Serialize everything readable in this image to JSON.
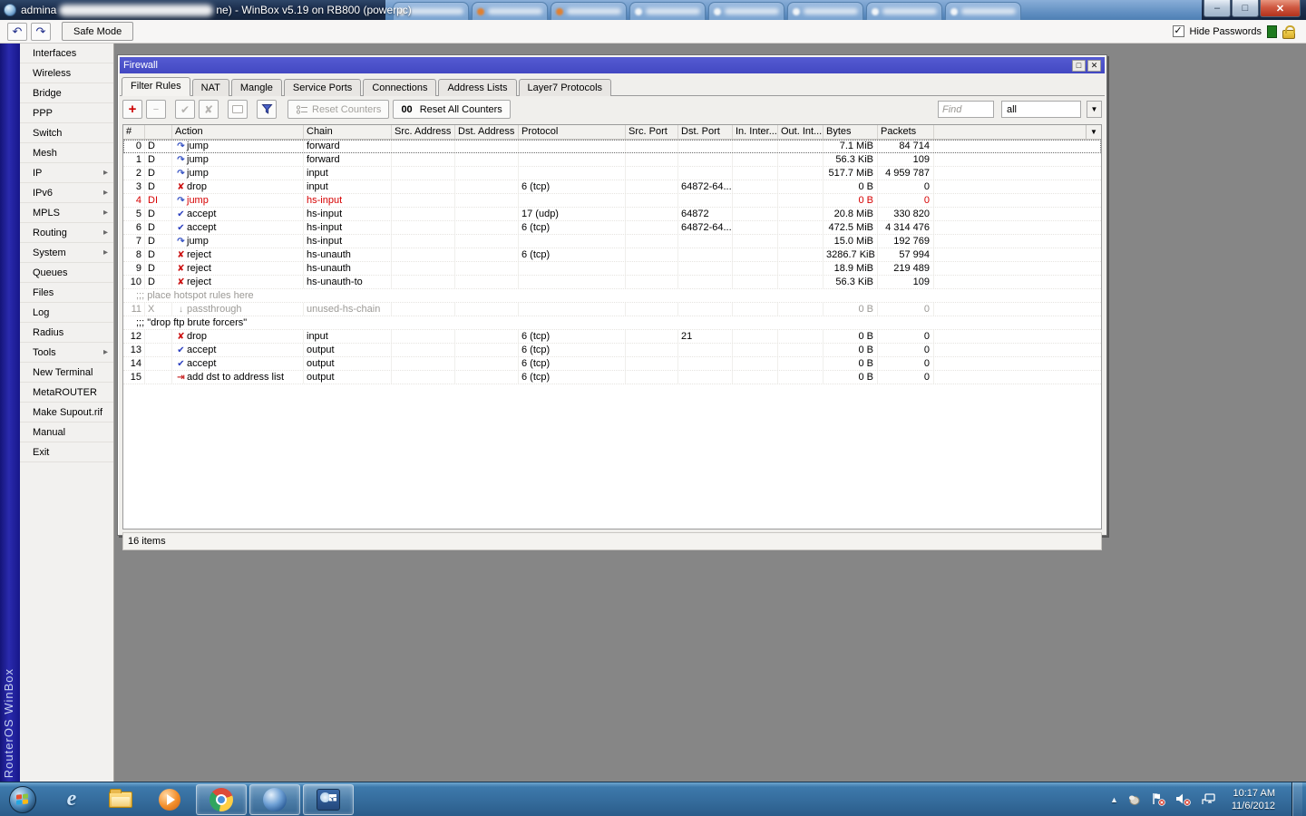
{
  "titlebar": {
    "title_prefix": "admina",
    "title_suffix": "ne) - WinBox v5.19 on RB800 (powerpc)",
    "buttons": {
      "minimize": "–",
      "maximize": "□",
      "close": "✕"
    }
  },
  "topbar": {
    "undo_icon": "↶",
    "redo_icon": "↷",
    "safe_mode_label": "Safe Mode",
    "hide_passwords_label": "Hide Passwords"
  },
  "sidebar": {
    "brand": "RouterOS WinBox",
    "items": [
      {
        "label": "Interfaces",
        "submenu": false
      },
      {
        "label": "Wireless",
        "submenu": false
      },
      {
        "label": "Bridge",
        "submenu": false
      },
      {
        "label": "PPP",
        "submenu": false
      },
      {
        "label": "Switch",
        "submenu": false
      },
      {
        "label": "Mesh",
        "submenu": false
      },
      {
        "label": "IP",
        "submenu": true
      },
      {
        "label": "IPv6",
        "submenu": true
      },
      {
        "label": "MPLS",
        "submenu": true
      },
      {
        "label": "Routing",
        "submenu": true
      },
      {
        "label": "System",
        "submenu": true
      },
      {
        "label": "Queues",
        "submenu": false
      },
      {
        "label": "Files",
        "submenu": false
      },
      {
        "label": "Log",
        "submenu": false
      },
      {
        "label": "Radius",
        "submenu": false
      },
      {
        "label": "Tools",
        "submenu": true
      },
      {
        "label": "New Terminal",
        "submenu": false
      },
      {
        "label": "MetaROUTER",
        "submenu": false
      },
      {
        "label": "Make Supout.rif",
        "submenu": false
      },
      {
        "label": "Manual",
        "submenu": false
      },
      {
        "label": "Exit",
        "submenu": false
      }
    ]
  },
  "firewall": {
    "title": "Firewall",
    "window_buttons": {
      "maximize": "□",
      "close": "✕"
    },
    "tabs": [
      "Filter Rules",
      "NAT",
      "Mangle",
      "Service Ports",
      "Connections",
      "Address Lists",
      "Layer7 Protocols"
    ],
    "active_tab": "Filter Rules",
    "toolbar": {
      "add_icon": "+",
      "remove_icon": "−",
      "enable_icon": "✔",
      "disable_icon": "✘",
      "reset_counters": "Reset Counters",
      "reset_all_prefix": "00",
      "reset_all_counters": "Reset All Counters",
      "find_placeholder": "Find",
      "filter_value": "all",
      "combo_arrow": "▼"
    },
    "columns": [
      "#",
      "",
      "Action",
      "Chain",
      "Src. Address",
      "Dst. Address",
      "Protocol",
      "Src. Port",
      "Dst. Port",
      "In. Inter...",
      "Out. Int...",
      "Bytes",
      "Packets"
    ],
    "rows": [
      {
        "type": "rule",
        "num": "0",
        "flags": "D",
        "action": "jump",
        "chain": "forward",
        "bytes": "7.1 MiB",
        "packets": "84 714",
        "state": "selected"
      },
      {
        "type": "rule",
        "num": "1",
        "flags": "D",
        "action": "jump",
        "chain": "forward",
        "bytes": "56.3 KiB",
        "packets": "109"
      },
      {
        "type": "rule",
        "num": "2",
        "flags": "D",
        "action": "jump",
        "chain": "input",
        "bytes": "517.7 MiB",
        "packets": "4 959 787"
      },
      {
        "type": "rule",
        "num": "3",
        "flags": "D",
        "action": "drop",
        "chain": "input",
        "protocol": "6 (tcp)",
        "dst_port": "64872-64...",
        "bytes": "0 B",
        "packets": "0"
      },
      {
        "type": "rule",
        "num": "4",
        "flags": "DI",
        "action": "jump",
        "chain": "hs-input",
        "bytes": "0 B",
        "packets": "0",
        "state": "invalid"
      },
      {
        "type": "rule",
        "num": "5",
        "flags": "D",
        "action": "accept",
        "chain": "hs-input",
        "protocol": "17 (udp)",
        "dst_port": "64872",
        "bytes": "20.8 MiB",
        "packets": "330 820"
      },
      {
        "type": "rule",
        "num": "6",
        "flags": "D",
        "action": "accept",
        "chain": "hs-input",
        "protocol": "6 (tcp)",
        "dst_port": "64872-64...",
        "bytes": "472.5 MiB",
        "packets": "4 314 476"
      },
      {
        "type": "rule",
        "num": "7",
        "flags": "D",
        "action": "jump",
        "chain": "hs-input",
        "bytes": "15.0 MiB",
        "packets": "192 769"
      },
      {
        "type": "rule",
        "num": "8",
        "flags": "D",
        "action": "reject",
        "chain": "hs-unauth",
        "protocol": "6 (tcp)",
        "bytes": "3286.7 KiB",
        "packets": "57 994"
      },
      {
        "type": "rule",
        "num": "9",
        "flags": "D",
        "action": "reject",
        "chain": "hs-unauth",
        "bytes": "18.9 MiB",
        "packets": "219 489"
      },
      {
        "type": "rule",
        "num": "10",
        "flags": "D",
        "action": "reject",
        "chain": "hs-unauth-to",
        "bytes": "56.3 KiB",
        "packets": "109"
      },
      {
        "type": "comment",
        "text": ";;; place hotspot rules here",
        "state": "disabled"
      },
      {
        "type": "rule",
        "num": "11",
        "flags": "X",
        "action": "passthrough",
        "chain": "unused-hs-chain",
        "bytes": "0 B",
        "packets": "0",
        "state": "disabled"
      },
      {
        "type": "comment",
        "text": ";;; \"drop ftp brute forcers\""
      },
      {
        "type": "rule",
        "num": "12",
        "flags": "",
        "action": "drop",
        "chain": "input",
        "protocol": "6 (tcp)",
        "dst_port": "21",
        "bytes": "0 B",
        "packets": "0"
      },
      {
        "type": "rule",
        "num": "13",
        "flags": "",
        "action": "accept",
        "chain": "output",
        "protocol": "6 (tcp)",
        "bytes": "0 B",
        "packets": "0"
      },
      {
        "type": "rule",
        "num": "14",
        "flags": "",
        "action": "accept",
        "chain": "output",
        "protocol": "6 (tcp)",
        "bytes": "0 B",
        "packets": "0"
      },
      {
        "type": "rule",
        "num": "15",
        "flags": "",
        "action": "add dst to address list",
        "chain": "output",
        "protocol": "6 (tcp)",
        "bytes": "0 B",
        "packets": "0"
      }
    ],
    "header_arrow": "▼",
    "status": "16 items"
  },
  "taskbar": {
    "time": "10:17 AM",
    "date": "11/6/2012",
    "tray_expand_icon": "▲"
  }
}
